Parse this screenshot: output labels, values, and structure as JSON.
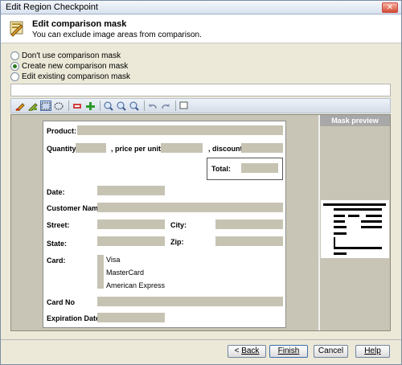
{
  "window": {
    "title": "Edit Region Checkpoint"
  },
  "header": {
    "title": "Edit comparison mask",
    "subtitle": "You can exclude image areas from comparison."
  },
  "options": [
    {
      "label": "Don't use comparison mask",
      "checked": false
    },
    {
      "label": "Create new comparison mask",
      "checked": true
    },
    {
      "label": "Edit existing comparison mask",
      "checked": false
    }
  ],
  "mask_path": {
    "value": ""
  },
  "toolbar": {
    "icons": [
      "pencil-icon",
      "pencil-clear-icon",
      "rect-select-icon",
      "ellipse-select-icon",
      "mask-remove-icon",
      "mask-add-icon",
      "zoom-in-icon",
      "zoom-out-icon",
      "zoom-fit-icon",
      "undo-icon",
      "redo-icon",
      "frame-icon"
    ]
  },
  "form": {
    "product": "Product:",
    "quantity": "Quantity:",
    "price_per_unit": ", price per unit:",
    "discount": ", discount:",
    "total": "Total:",
    "date": "Date:",
    "customer_name": "Customer Name:",
    "street": "Street:",
    "city": "City:",
    "state": "State:",
    "zip": "Zip:",
    "card": "Card:",
    "card_options": [
      "Visa",
      "MasterCard",
      "American Express"
    ],
    "card_no": "Card No",
    "expiration_date": "Expiration Date:"
  },
  "preview": {
    "title": "Mask preview"
  },
  "buttons": {
    "back": "Back",
    "finish": "Finish",
    "cancel": "Cancel",
    "help": "Help"
  },
  "colors": {
    "mask_field": "#c7c3b3",
    "canvas_bg": "#c9c5b6",
    "preview_header": "#a8a8a8",
    "toolbar_bg": "#dde4ee"
  }
}
